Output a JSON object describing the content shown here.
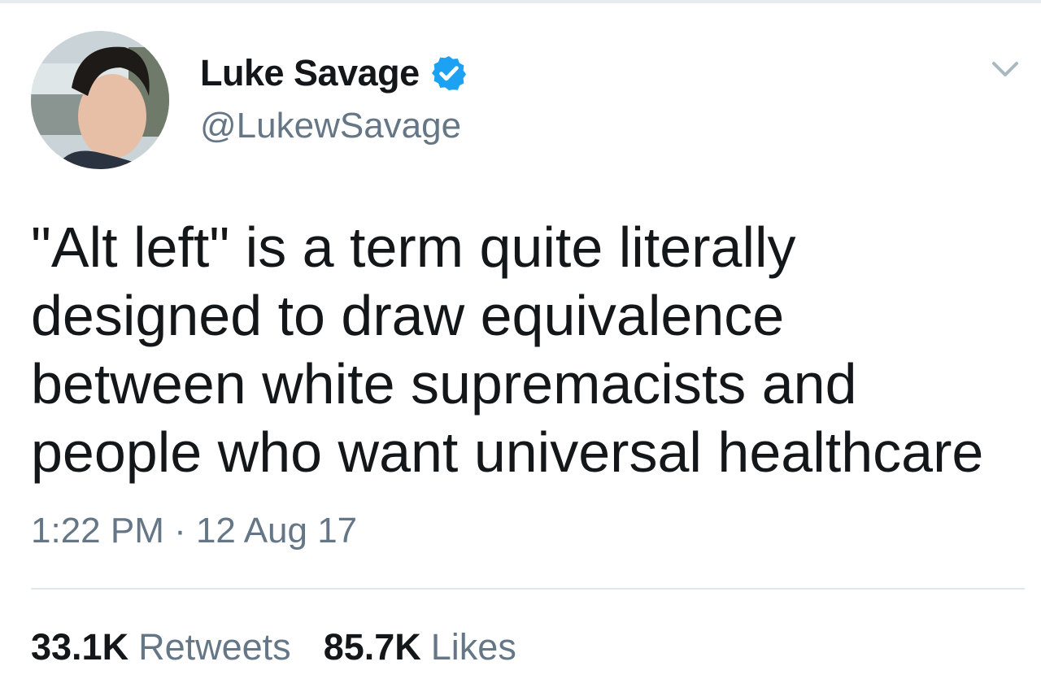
{
  "tweet": {
    "author": {
      "display_name": "Luke Savage",
      "handle": "@LukewSavage",
      "verified": true,
      "verified_color": "#1da1f2"
    },
    "text": "\"Alt left\" is a term quite literally\ndesigned to draw equivalence\nbetween white supremacists and\npeople who want universal healthcare",
    "timestamp": "1:22 PM · 12 Aug 17",
    "stats": {
      "retweets_count": "33.1K",
      "retweets_label": "Retweets",
      "likes_count": "85.7K",
      "likes_label": "Likes"
    }
  },
  "icons": {
    "verified": "verified-badge-icon",
    "menu": "chevron-down-icon"
  },
  "colors": {
    "text_primary": "#14171a",
    "text_secondary": "#657786",
    "divider": "#e1e8ed"
  }
}
